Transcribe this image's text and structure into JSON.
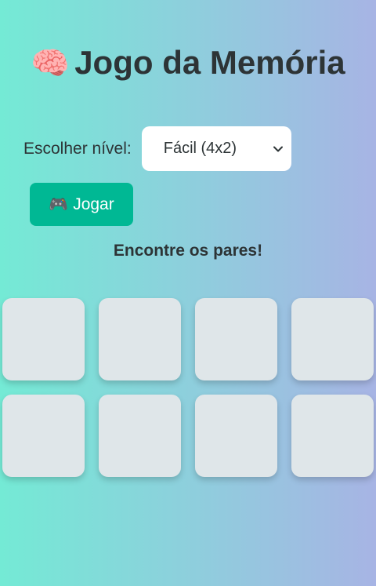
{
  "header": {
    "icon": "brain-icon",
    "icon_glyph": "🧠",
    "title": "Jogo da Memória"
  },
  "level": {
    "label": "Escolher nível:",
    "selected": "Fácil (4x2)"
  },
  "play_button": {
    "icon": "gamepad-icon",
    "icon_glyph": "🎮",
    "label": "Jogar"
  },
  "status": "Encontre os pares!",
  "board": {
    "columns": 4,
    "rows": 2,
    "cards": [
      {
        "face": "hidden"
      },
      {
        "face": "hidden"
      },
      {
        "face": "hidden"
      },
      {
        "face": "hidden"
      },
      {
        "face": "hidden"
      },
      {
        "face": "hidden"
      },
      {
        "face": "hidden"
      },
      {
        "face": "hidden"
      }
    ]
  },
  "colors": {
    "background_start": "#74ead5",
    "background_end": "#a7b4e4",
    "accent": "#00b894",
    "card": "#dfe6e9",
    "text": "#2d3436"
  }
}
